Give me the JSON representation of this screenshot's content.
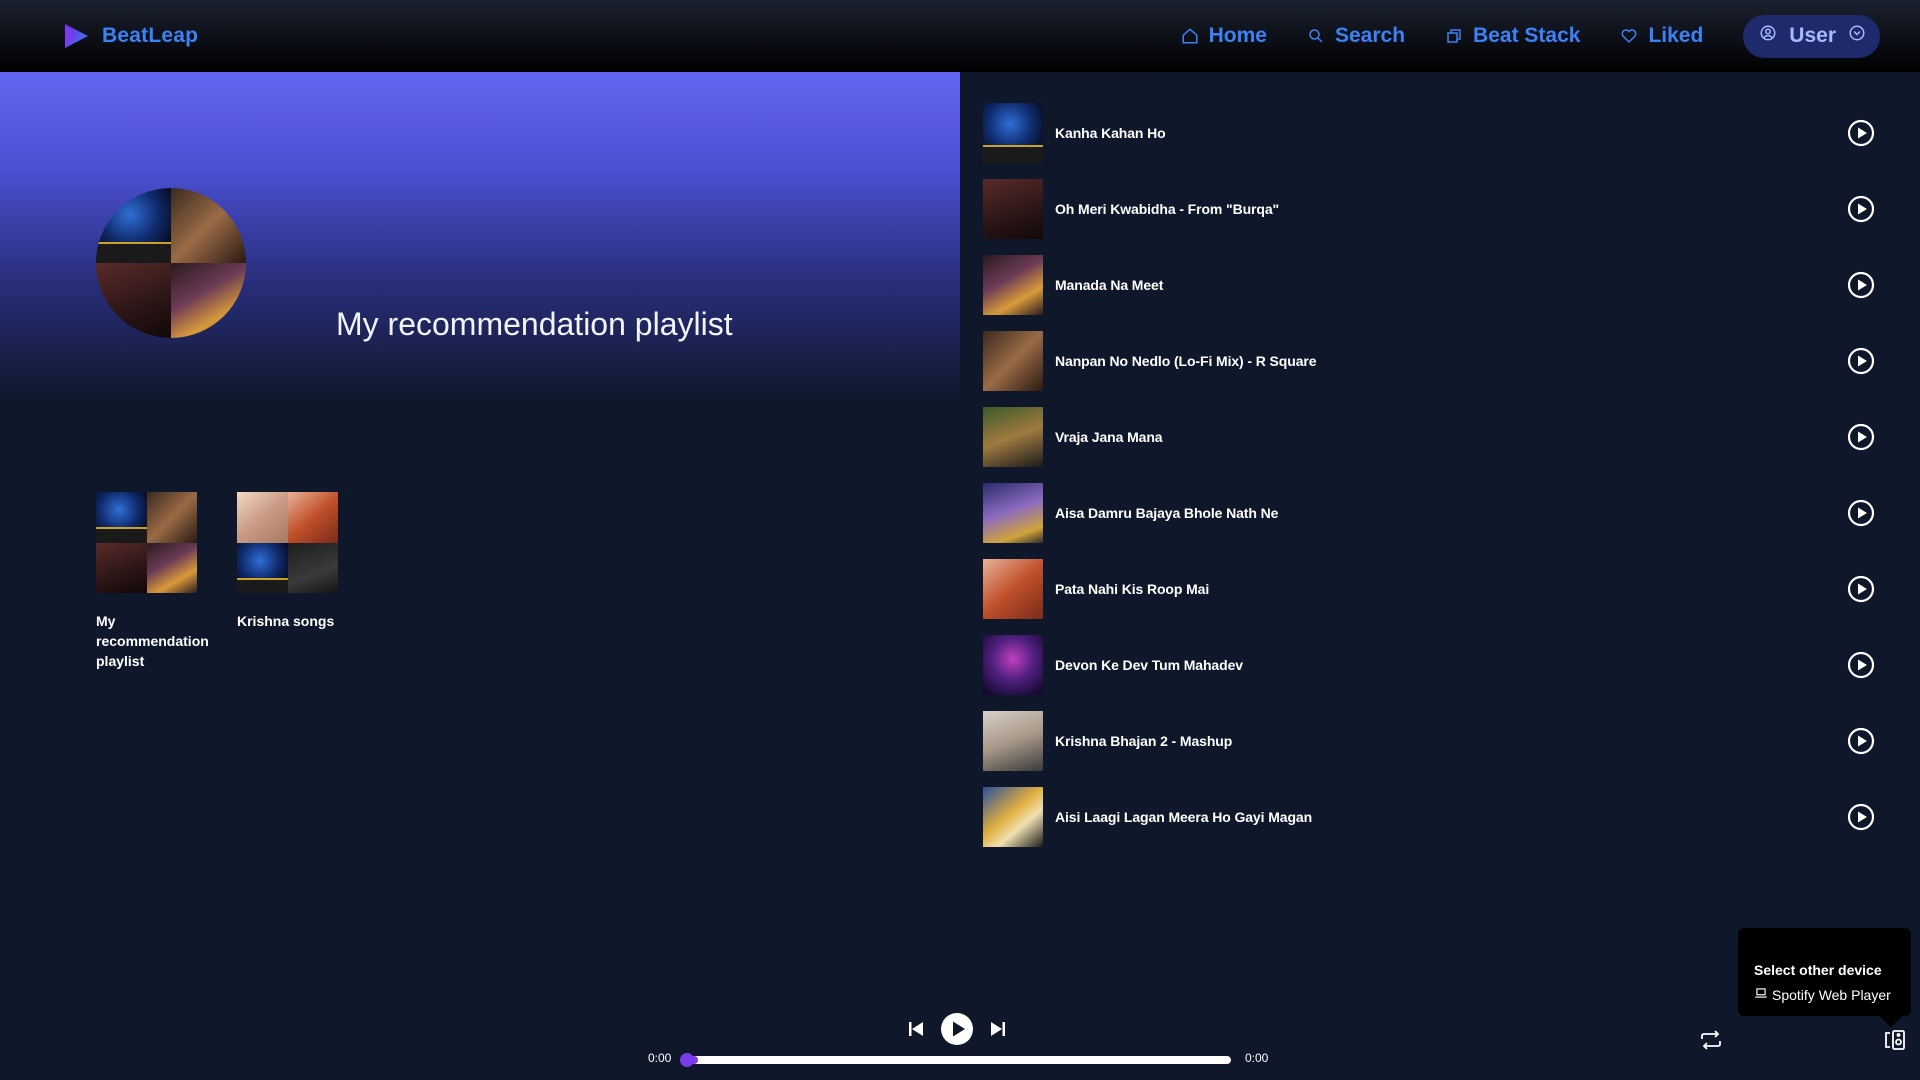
{
  "app": {
    "name": "BeatLeap"
  },
  "nav": {
    "items": [
      {
        "label": "Home",
        "icon": "home-icon"
      },
      {
        "label": "Search",
        "icon": "search-icon"
      },
      {
        "label": "Beat Stack",
        "icon": "stack-icon"
      },
      {
        "label": "Liked",
        "icon": "heart-icon"
      }
    ],
    "user_label": "User"
  },
  "hero": {
    "title": "My recommendation playlist"
  },
  "playlists": [
    {
      "title": "My recommendation playlist"
    },
    {
      "title": "Krishna songs"
    }
  ],
  "tracks": [
    {
      "title": "Kanha Kahan Ho"
    },
    {
      "title": "Oh Meri Kwabidha - From \"Burqa\""
    },
    {
      "title": "Manada Na Meet"
    },
    {
      "title": "Nanpan No Nedlo (Lo-Fi Mix) - R Square"
    },
    {
      "title": "Vraja Jana Mana"
    },
    {
      "title": "Aisa Damru Bajaya Bhole Nath Ne"
    },
    {
      "title": "Pata Nahi Kis Roop Mai"
    },
    {
      "title": "Devon Ke Dev Tum Mahadev"
    },
    {
      "title": "Krishna Bhajan 2 - Mashup"
    },
    {
      "title": "Aisi Laagi Lagan Meera Ho Gayi Magan"
    }
  ],
  "device_popover": {
    "heading": "Select other device",
    "device_name": "Spotify Web Player"
  },
  "player": {
    "current_time": "0:00",
    "total_time": "0:00",
    "progress": 0
  },
  "colors": {
    "background": "#0f172a",
    "accent": "#3b82f6",
    "hero_gradient_top": "#6366f1",
    "progress": "#7c3aed"
  }
}
